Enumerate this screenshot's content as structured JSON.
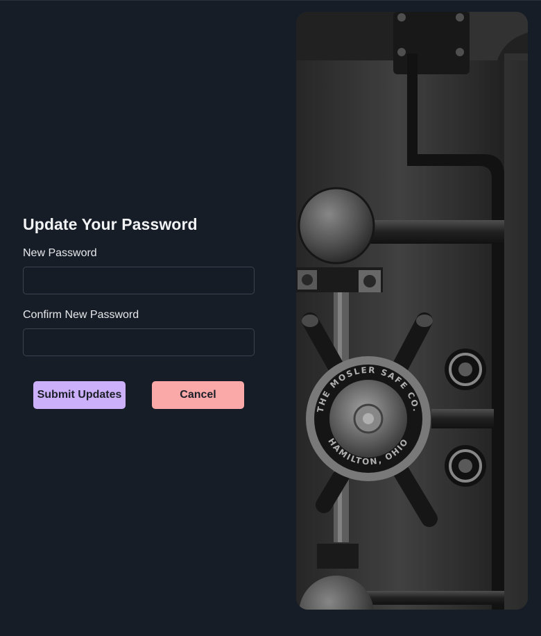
{
  "form": {
    "title": "Update Your Password",
    "new_password_label": "New Password",
    "new_password_value": "",
    "confirm_password_label": "Confirm New Password",
    "confirm_password_value": ""
  },
  "actions": {
    "submit_label": "Submit Updates",
    "cancel_label": "Cancel"
  },
  "image": {
    "description_icon": "vault-door-image",
    "dial_text_top": "THE MOSLER SAFE CO.",
    "dial_text_bottom": "HAMILTON, OHIO"
  },
  "colors": {
    "background": "#171d26",
    "submit_button": "#cdb0fa",
    "cancel_button": "#fba8a8",
    "input_border": "#3b4250"
  }
}
